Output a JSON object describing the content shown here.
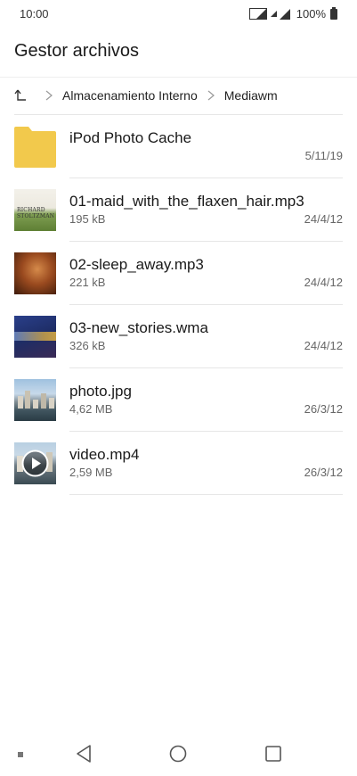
{
  "status_bar": {
    "time": "10:00",
    "battery": "100%"
  },
  "app_bar": {
    "title": "Gestor archivos"
  },
  "breadcrumb": {
    "items": [
      "Almacenamiento Interno",
      "Mediawm"
    ]
  },
  "files": [
    {
      "name": "iPod Photo Cache",
      "size": "",
      "date": "5/11/19",
      "icon": "folder-icon"
    },
    {
      "name": "01-maid_with_the_flaxen_hair.mp3",
      "size": "195 kB",
      "date": "24/4/12",
      "icon": "album-art-thumbnail",
      "thumb_text": "RICHARD STOLTZMAN"
    },
    {
      "name": "02-sleep_away.mp3",
      "size": "221 kB",
      "date": "24/4/12",
      "icon": "album-art-thumbnail"
    },
    {
      "name": "03-new_stories.wma",
      "size": "326 kB",
      "date": "24/4/12",
      "icon": "album-art-thumbnail"
    },
    {
      "name": "photo.jpg",
      "size": "4,62 MB",
      "date": "26/3/12",
      "icon": "image-thumbnail"
    },
    {
      "name": "video.mp4",
      "size": "2,59 MB",
      "date": "26/3/12",
      "icon": "video-thumbnail"
    }
  ],
  "colors": {
    "folder": "#f2c94c",
    "text_primary": "#1a1a1a",
    "text_secondary": "#666666",
    "divider": "#e6e6e6"
  }
}
